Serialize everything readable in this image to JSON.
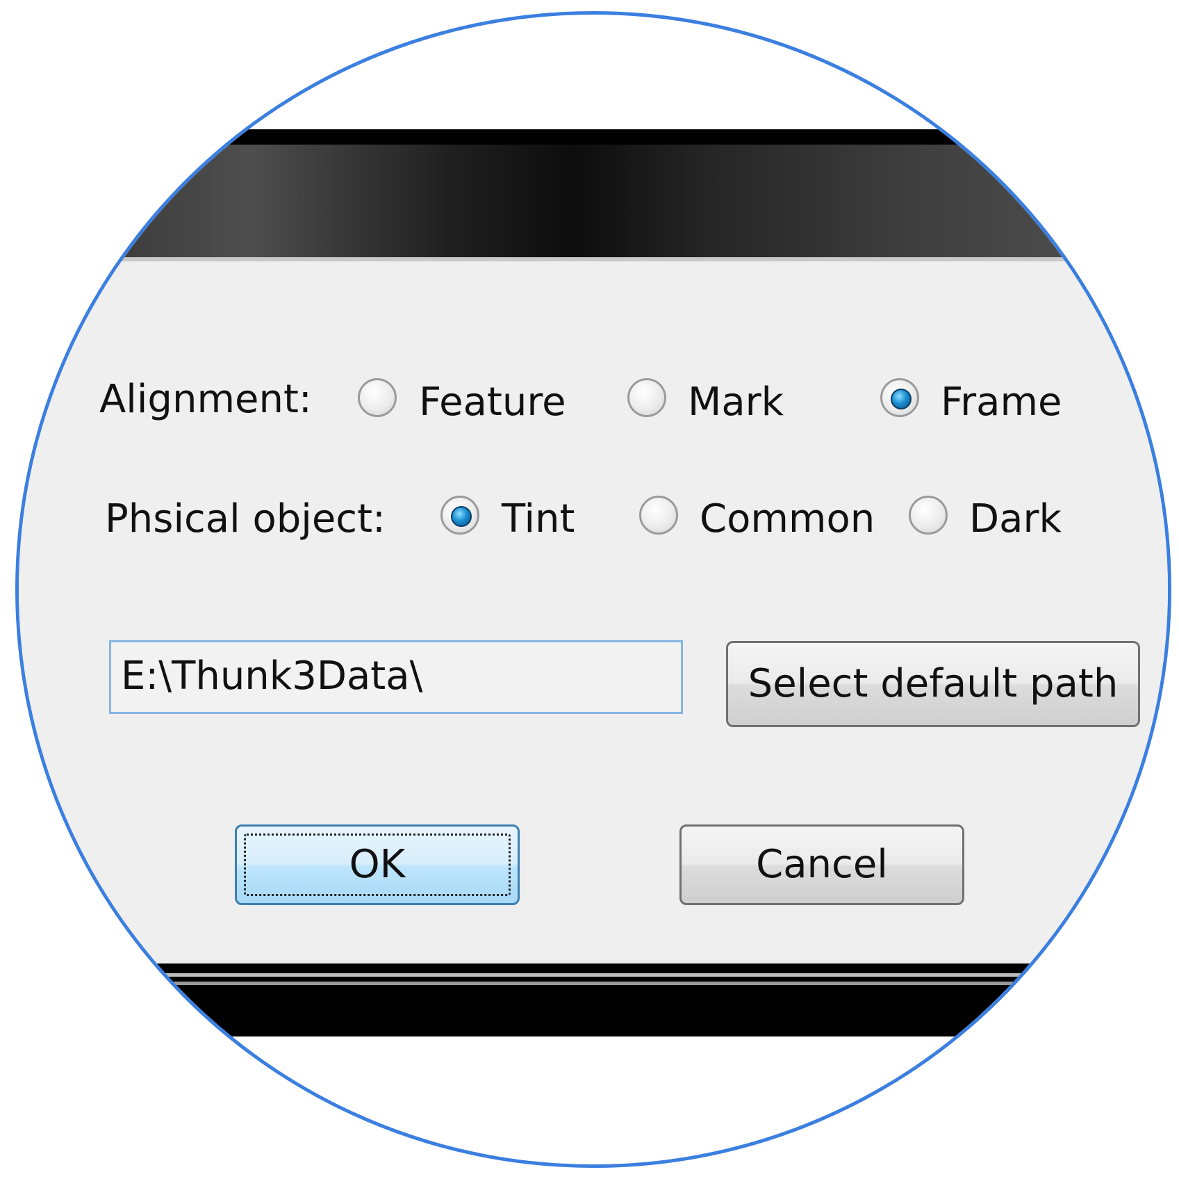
{
  "dialog": {
    "alignment": {
      "label": "Alignment:",
      "options": [
        {
          "label": "Feature",
          "checked": false
        },
        {
          "label": "Mark",
          "checked": false
        },
        {
          "label": "Frame",
          "checked": true
        }
      ]
    },
    "physical_object": {
      "label": "Phsical object:",
      "options": [
        {
          "label": "Tint",
          "checked": true
        },
        {
          "label": "Common",
          "checked": false
        },
        {
          "label": "Dark",
          "checked": false
        }
      ]
    },
    "path": {
      "value": "E:\\Thunk3Data\\"
    },
    "buttons": {
      "select_path": "Select default path",
      "ok": "OK",
      "cancel": "Cancel"
    }
  },
  "colors": {
    "lens_border": "#3b7fe0",
    "dialog_background": "#efefef",
    "radio_checked": "#1b8fd0",
    "default_button": "#bee6fd"
  }
}
